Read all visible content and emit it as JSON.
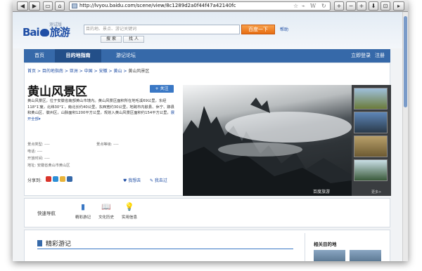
{
  "browser": {
    "url": "http://lvyou.baidu.com/scene/view/8c1289d2a0f44f47a42140fc",
    "url_icons": [
      "star-icon",
      "rss-icon",
      "wikipedia-icon",
      "reload-icon"
    ],
    "buttons": [
      "back-icon",
      "forward-icon",
      "sidebar-icon",
      "home-icon",
      "add-icon",
      "zoom-out-icon",
      "zoom-in-icon",
      "download-icon",
      "feed-icon",
      "menu-icon"
    ],
    "button_glyphs": {
      "back": "◀",
      "forward": "▶",
      "sidebar": "▭",
      "home": "⌂",
      "add": "+",
      "zoom_out": "−",
      "zoom_in": "+",
      "download": "⬇",
      "feed": "⊡",
      "menu": "▸"
    }
  },
  "header": {
    "logo_text": "Bai",
    "logo_suffix": "旅游",
    "logo_tag": "测试版",
    "search_placeholder": "目的地、景点、游记关键词",
    "search_button": "百度一下",
    "help": "帮助",
    "search_tabs": [
      "搜 索",
      "找 人"
    ]
  },
  "nav": {
    "items": [
      "首页",
      "目的地指南",
      "游记论坛"
    ],
    "active": "目的地指南",
    "right": [
      "立即登录",
      "注册"
    ]
  },
  "breadcrumb": [
    "首页",
    "目的地指南",
    "亚洲",
    "中国",
    "安徽",
    "黄山",
    "黄山风景区"
  ],
  "breadcrumb_sep": ">",
  "scene": {
    "title": "黄山风景区",
    "follow": "+ 关注",
    "description": "黄山风景区，位于安徽省南部黄山市境内。黄山风景区面积所在地毛溪69公里，东经118°1′度，北纬30°1′，南北长约40公里，东西宽约30公里，地跨市内歙县、休宁、黟县和黄山区、徽州区，山脉面积1200平方公里，规划入黄山风景区面积约154平方公里，",
    "more": "展开全部",
    "more_icon": "▾",
    "info": {
      "type": "景点类型: ----",
      "level": "景点等级: ----",
      "phone": "电话: ----",
      "hours": "开放时间: ----",
      "address": "地址: 安徽省黄山市黄山区"
    },
    "share_label": "分享到:",
    "been": "♥ 我想去",
    "gone": "✎ 我去过",
    "photo_watermark": "百度旅游",
    "more_photos": "更多>"
  },
  "quick_nav": {
    "label": "快速导航",
    "items": [
      {
        "label": "精彩游记",
        "icon": "book-icon",
        "glyph": "▮"
      },
      {
        "label": "文化历史",
        "icon": "open-book-icon",
        "glyph": "📖"
      },
      {
        "label": "实用信息",
        "icon": "lightbulb-icon",
        "glyph": "💡"
      }
    ]
  },
  "section": {
    "title": "精彩游记",
    "related": "相关目的地"
  },
  "colors": {
    "nav": "#3669a9",
    "accent": "#3a78c5",
    "search_button": "#f08a2c"
  }
}
